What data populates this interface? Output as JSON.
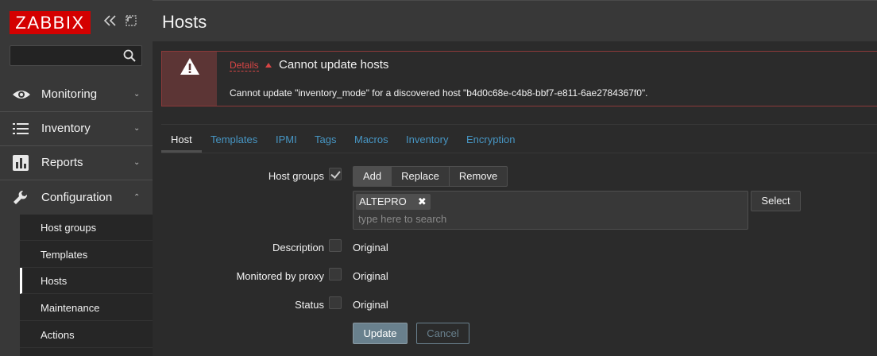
{
  "sidebar": {
    "logo": "ZABBIX",
    "collapse_icon": "chevrons-left-icon",
    "kiosk_icon": "fullscreen-icon",
    "search": {
      "placeholder": "",
      "icon": "search-icon"
    },
    "menu": [
      {
        "label": "Monitoring",
        "icon": "eye-icon"
      },
      {
        "label": "Inventory",
        "icon": "list-icon"
      },
      {
        "label": "Reports",
        "icon": "bar-chart-icon"
      },
      {
        "label": "Configuration",
        "icon": "wrench-icon"
      }
    ],
    "submenu": [
      "Host groups",
      "Templates",
      "Hosts",
      "Maintenance",
      "Actions"
    ]
  },
  "header": {
    "title": "Hosts"
  },
  "error": {
    "details_label": "Details",
    "title": "Cannot update hosts",
    "message": "Cannot update \"inventory_mode\" for a discovered host \"b4d0c68e-c4b8-bbf7-e811-6ae2784367f0\"."
  },
  "tabs": [
    "Host",
    "Templates",
    "IPMI",
    "Tags",
    "Macros",
    "Inventory",
    "Encryption"
  ],
  "form": {
    "host_groups_label": "Host groups",
    "host_groups_checked": true,
    "seg_buttons": [
      "Add",
      "Replace",
      "Remove"
    ],
    "selected_tag": "ALTEPRO",
    "search_placeholder": "type here to search",
    "select_label": "Select",
    "description_label": "Description",
    "proxy_label": "Monitored by proxy",
    "status_label": "Status",
    "original_text": "Original",
    "update_label": "Update",
    "cancel_label": "Cancel"
  },
  "colors": {
    "brand": "#d40000",
    "link": "#4796c4",
    "error": "#d74545"
  }
}
